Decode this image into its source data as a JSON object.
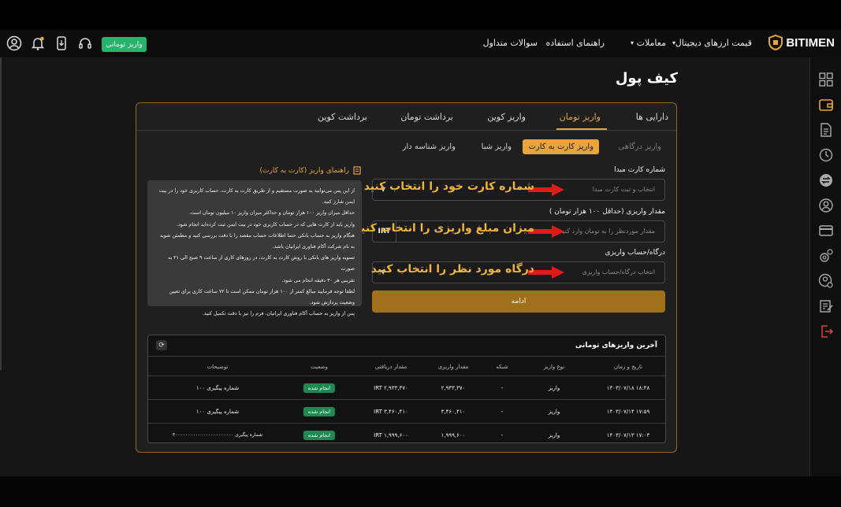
{
  "header": {
    "brand": "BITIMEN",
    "nav": [
      "قیمت ارزهای دیجیتال",
      "معاملات",
      "راهنمای استفاده",
      "سوالات متداول"
    ],
    "deposit_button": "واریز تومانی",
    "accent": "#e7a53a",
    "success": "#26b46a"
  },
  "page": {
    "title": "کیف پول"
  },
  "tabs": [
    "دارایی ها",
    "واریز تومان",
    "واریز کوین",
    "برداشت تومان",
    "برداشت کوین"
  ],
  "active_tab": "واریز تومان",
  "subtabs": [
    "واریز درگاهی",
    "واریز کارت به کارت",
    "واریز شبا",
    "واریز شناسه دار"
  ],
  "active_subtab": "واریز کارت به کارت",
  "form": {
    "card_label": "شماره کارت مبدا",
    "card_placeholder": "انتخاب و ثبت کارت مبدا",
    "amount_label": "مقدار واریزی (حداقل ۱۰۰ هزار تومان )",
    "amount_placeholder": "مقدار موردنظر را به تومان وارد کنید",
    "amount_unit": "IRT",
    "gateway_label": "درگاه/حساب واریزی",
    "gateway_placeholder": "انتخاب درگاه/حساب واریزی",
    "continue": "ادامه"
  },
  "annotations": [
    "شماره کارت خود را انتخاب کنید",
    "میزان مبلغ واریزی را انتخاب کنید",
    "درگاه مورد نظر را انتخاب کنید"
  ],
  "guide": {
    "title": "راهنمای واریز (کارت به کارت)",
    "lines": [
      "از این پس می‌توانید به صورت مستقیم و از طریق کارت به کارت، حساب کاربری خود را در بیت",
      "ایمن شارژ کنید.",
      "حداقل میزان واریز ۱۰۰ هزار تومان و حداکثر میزان واریز ۱۰ میلیون تومان است.",
      "واریز باید از کارت هایی که در حساب کاربری خود در بیت ایمن ثبت کرده‌اید انجام شود.",
      "هنگام واریز به حساب بانکی حتما اطلاعات حساب مقصد را با دقت بررسی کنید و مطمئن شوید",
      "به نام شرکت آکام فناوری ایرانیان باشد.",
      "تسویه واریز های بانکی با روش کارت به کارت، در روزهای کاری از ساعت ۹ صبح الی ۲۱ به صورت",
      "تقریبی هر ۳۰ دقیقه انجام می شود.",
      "لطفا توجه فرمایید مبالغ کمتر از ۱۰۰ هزار تومان ممکن است تا ۷۲ ساعت کاری برای تعیین",
      "وضعیت پردازش شود.",
      "پس از واریز به حساب آکام فناوری ایرانیان، فرم را نیز با دقت تکمیل کنید."
    ]
  },
  "recent": {
    "title": "آخرین واریزهای تومانی",
    "columns": [
      "تاریخ و زمان",
      "نوع واریز",
      "شبکه",
      "مقدار واریزی",
      "مقدار دریافتی",
      "وضعیت",
      "توضیحات"
    ],
    "rows": [
      [
        "۱۴۰۳/۰۷/۱۸ ۱۸:۳۸",
        "واریز",
        "-",
        "۲,۹۳۳,۳۷۰",
        "IRT ۲,۹۳۳,۳۷۰",
        "انجام شده",
        "شماره پیگیری ۱۰۰"
      ],
      [
        "۱۴۰۳/۰۷/۱۴ ۱۷:۵۹",
        "واریز",
        "-",
        "۳,۴۶۰,۴۱۰",
        "IRT ۳,۴۶۰,۴۱۰",
        "انجام شده",
        "شماره پیگیری ۱۰۰"
      ],
      [
        "۱۴۰۳/۰۷/۱۳ ۱۷:۰۳",
        "واریز",
        "-",
        "۱,۹۹۹,۶۰۰",
        "IRT ۱,۹۹۹,۶۰۰",
        "انجام شده",
        "شماره پیگیری ۳۰۰۰۰۰۰۰۰۰۰۰۰۰۰۰۰۰۰۰۰۰۰۰"
      ]
    ]
  }
}
